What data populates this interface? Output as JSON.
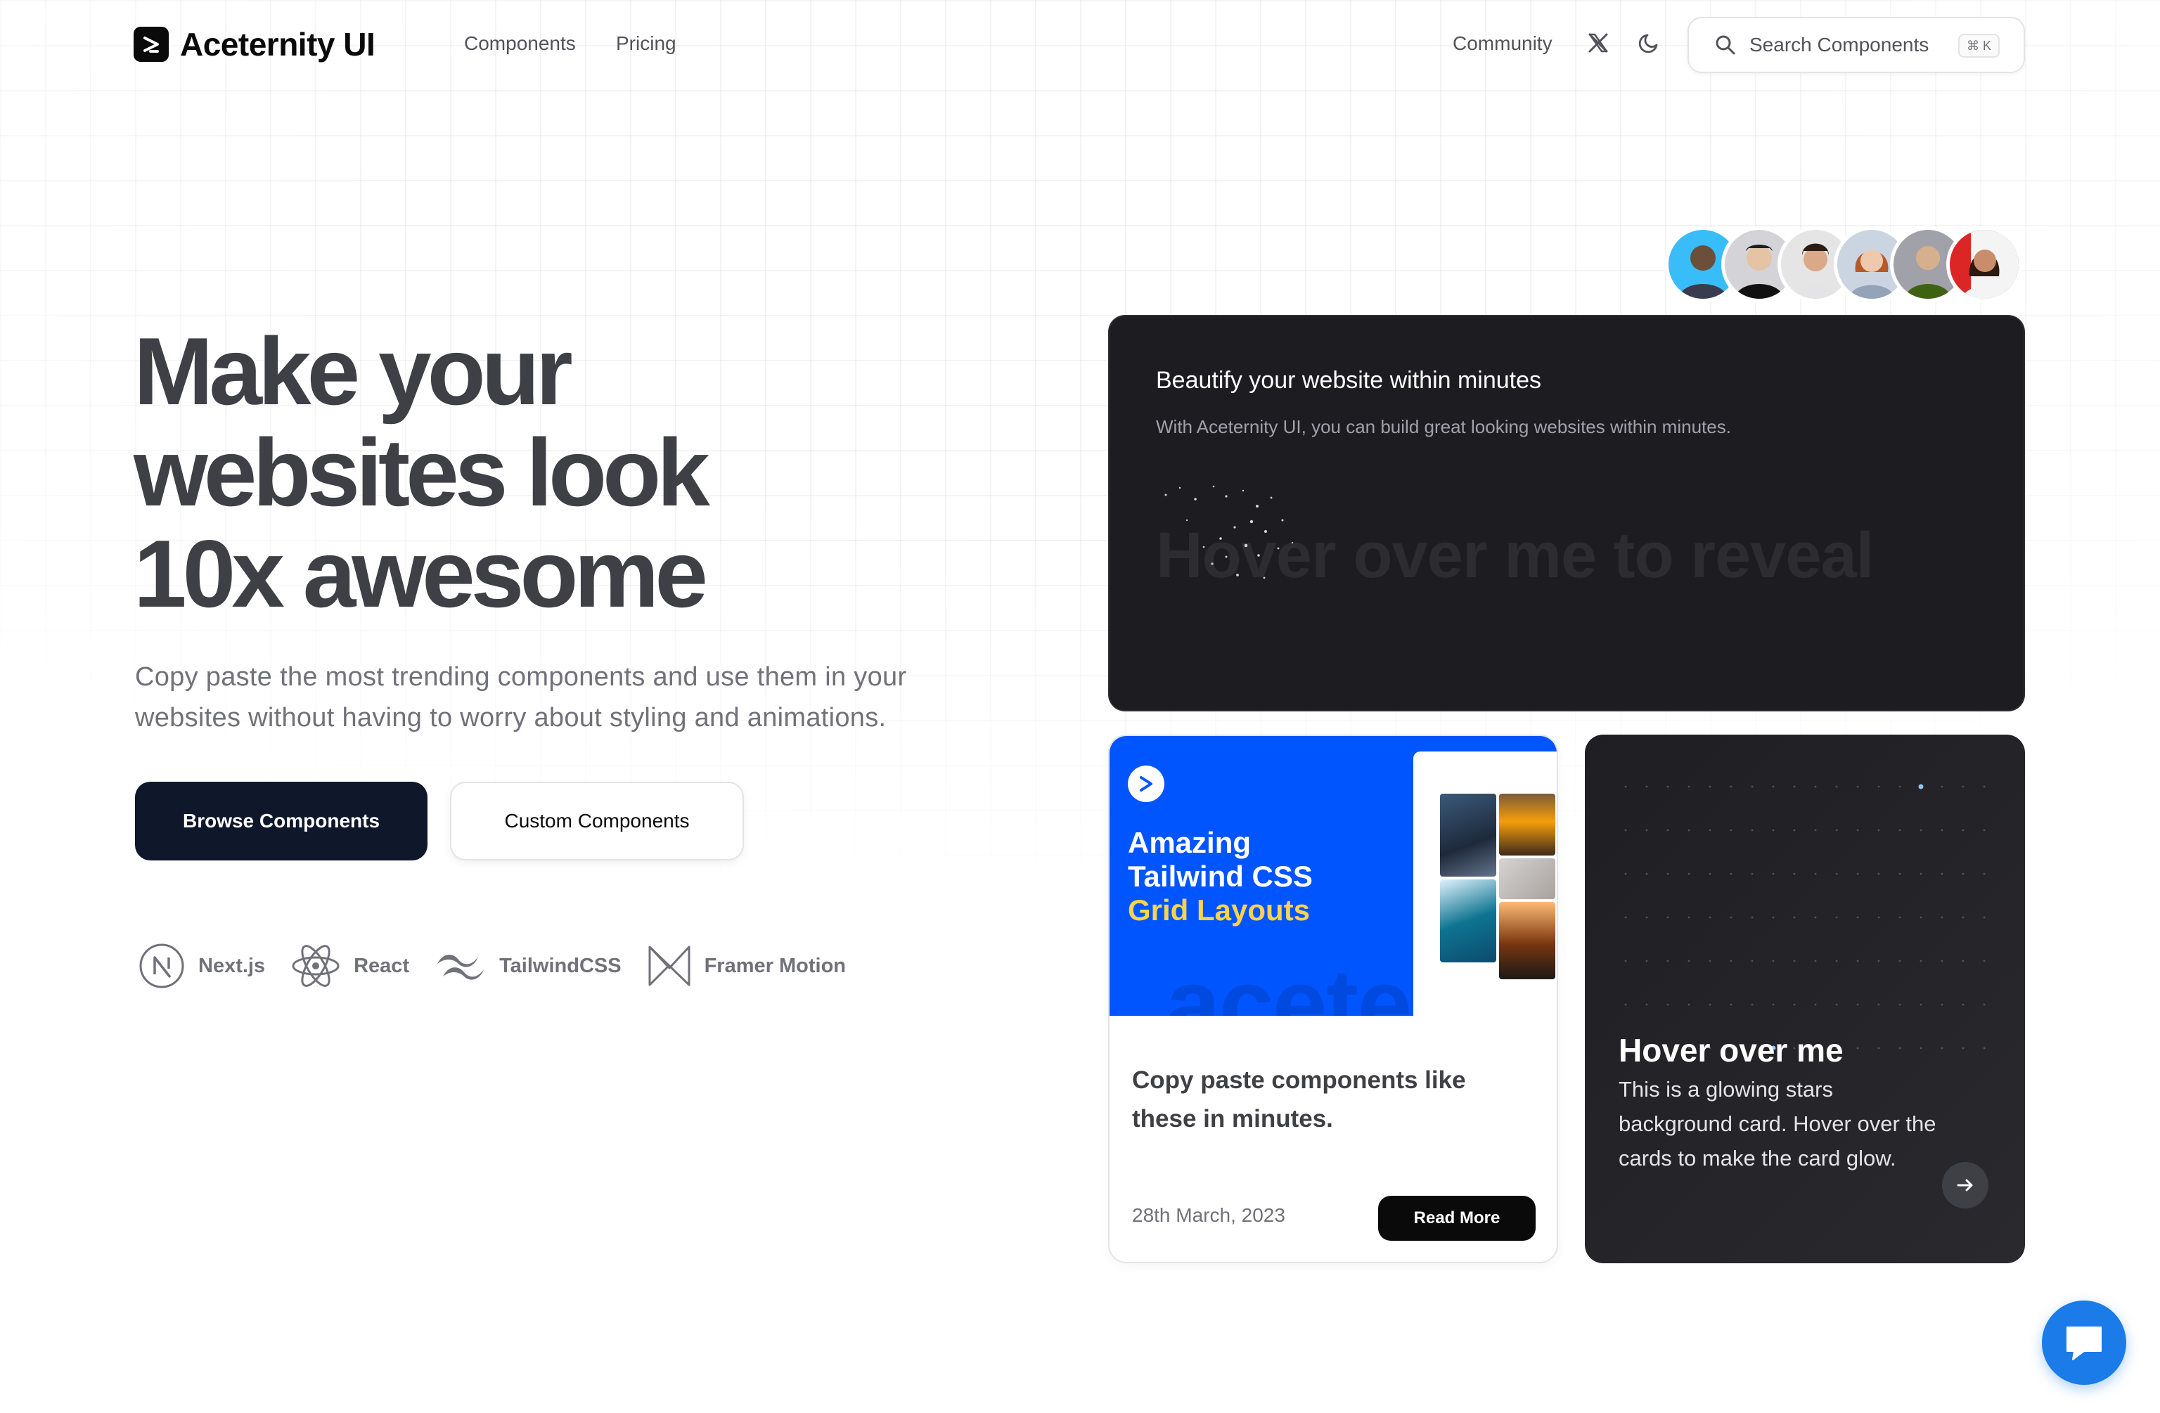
{
  "brand": {
    "name": "Aceternity UI"
  },
  "nav": {
    "links": [
      "Components",
      "Pricing"
    ],
    "community": "Community",
    "search": {
      "placeholder": "Search Components",
      "shortcut": "⌘ K"
    }
  },
  "hero": {
    "title_lines": [
      "Make your",
      "websites look",
      "10x awesome"
    ],
    "subtitle": "Copy paste the most trending components and use them in your websites without having to worry about styling and animations.",
    "primary_button": "Browse Components",
    "secondary_button": "Custom Components",
    "tech": [
      "Next.js",
      "React",
      "TailwindCSS",
      "Framer Motion"
    ]
  },
  "avatars": {
    "count": 6,
    "colors": [
      "#38bdf8",
      "#d4d4d8",
      "#e5e5e5",
      "#cbd5e1",
      "#a1a1aa",
      "#dc2626"
    ]
  },
  "reveal_card": {
    "title": "Beautify your website within minutes",
    "description": "With Aceternity UI, you can build great looking websites within minutes.",
    "reveal_text": "Hover over me to reveal"
  },
  "blog_card": {
    "image_text": {
      "line1": "Amazing",
      "line2": "Tailwind CSS",
      "line3": "Grid Layouts",
      "watermark": "acete"
    },
    "title": "Copy paste components like these in minutes.",
    "date": "28th March, 2023",
    "button": "Read More"
  },
  "stars_card": {
    "title": "Hover over me",
    "description": "This is a glowing stars background card. Hover over the cards to make the card glow."
  },
  "colors": {
    "primary_button": "#0f172a",
    "blue_card": "#0055ff",
    "chat": "#1b7be8",
    "heading": "#3f3f46"
  }
}
